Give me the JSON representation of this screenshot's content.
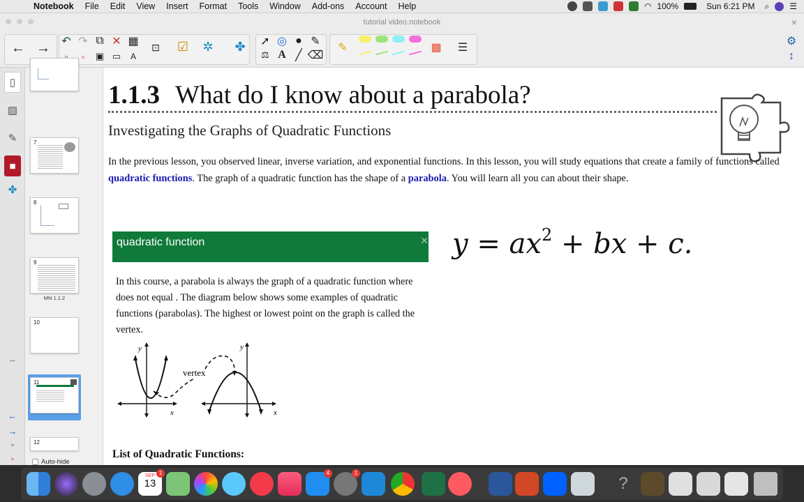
{
  "menubar": {
    "app_name": "Notebook",
    "items": [
      "File",
      "Edit",
      "View",
      "Insert",
      "Format",
      "Tools",
      "Window",
      "Add-ons",
      "Account",
      "Help"
    ],
    "battery": "100%",
    "clock": "Sun 6:21 PM"
  },
  "window": {
    "title": "tutorial video.notebook"
  },
  "sorter": {
    "thumbs": [
      {
        "num": ""
      },
      {
        "num": "7"
      },
      {
        "num": "8"
      },
      {
        "num": "9",
        "label": "MN 1.1.2"
      },
      {
        "num": "10"
      },
      {
        "num": "11"
      },
      {
        "num": "12"
      }
    ],
    "autohide": "Auto-hide"
  },
  "page": {
    "lesson_number": "1.1.3",
    "lesson_title": "What do I know about a parabola?",
    "subtitle": "Investigating the Graphs of Quadratic Functions",
    "intro_1": "In the previous lesson, you observed linear, inverse variation, and exponential functions.  In this lesson, you will study equations that create a family of functions called ",
    "intro_key_1": "quadratic functions",
    "intro_2": ".  The graph of a quadratic function has the shape of a ",
    "intro_key_2": "parabola",
    "intro_3": ".  You will learn all you can about their  shape.",
    "definition_title": "quadratic function",
    "definition_body": "In this course, a parabola is always the graph of a quadratic function  where does not equal .  The diagram below shows some examples of quadratic functions (parabolas).  The highest or lowest point on the graph is called the vertex.",
    "formula": "y = ax",
    "formula_exp": "2",
    "formula_rest": " + bx + c.",
    "diagram_vertex": "vertex",
    "diagram_x": "x",
    "diagram_y": "y",
    "list_heading": "List of Quadratic Functions:"
  },
  "dock": {
    "calendar_month": "SEP",
    "calendar_day": "13",
    "badges": [
      "1",
      "4",
      "1"
    ]
  }
}
